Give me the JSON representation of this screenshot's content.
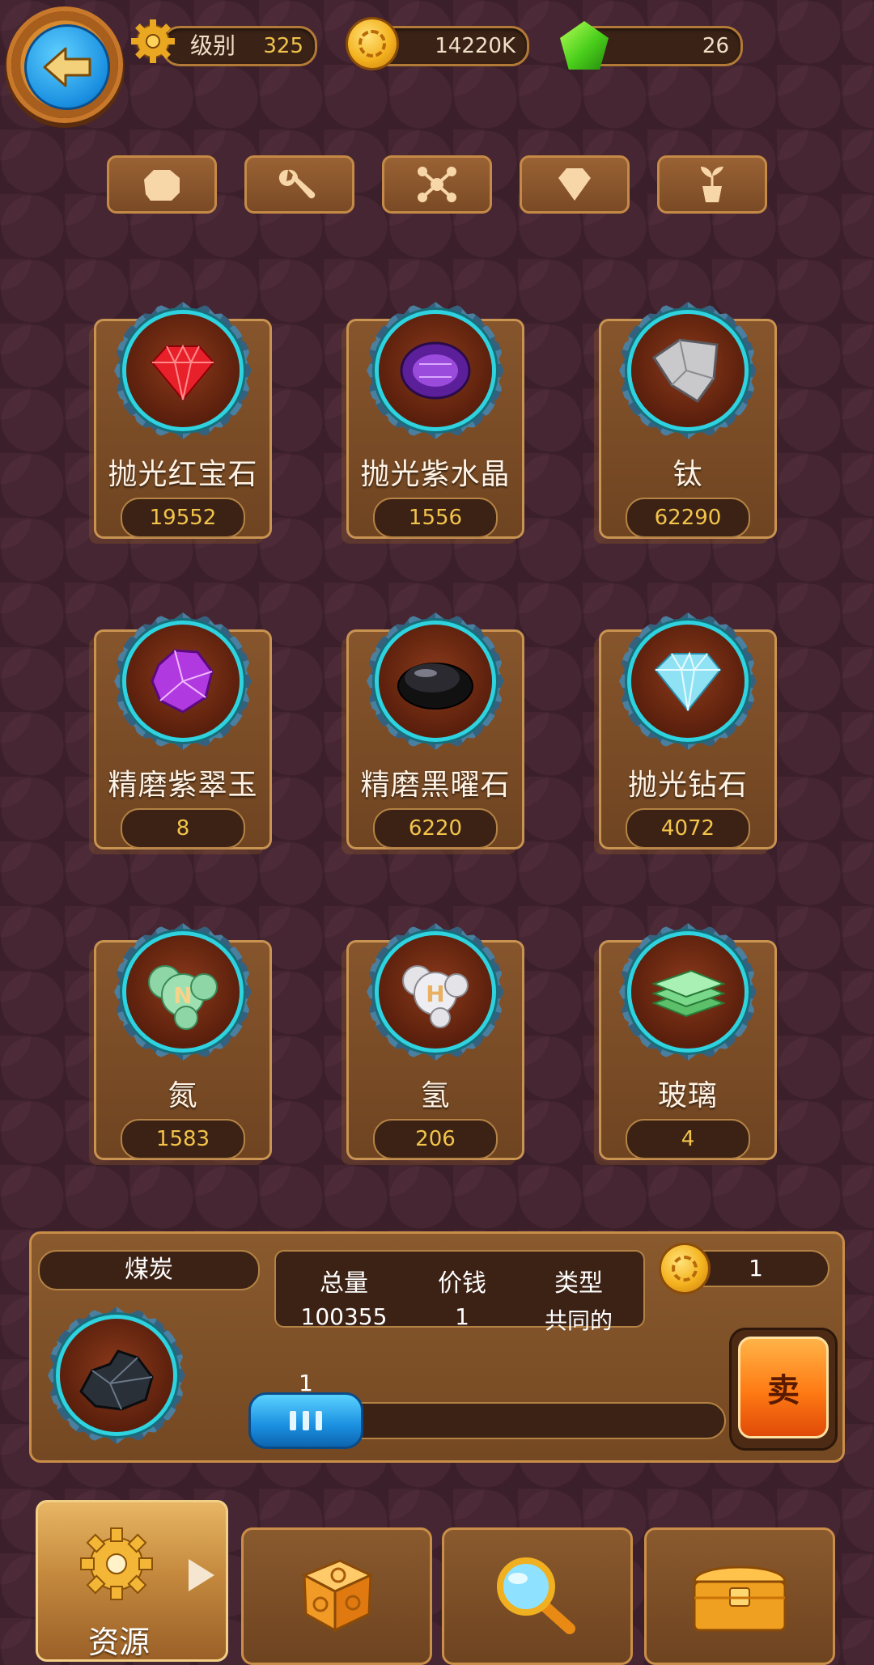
{
  "header": {
    "level_label": "级别",
    "level_value": "325",
    "coins": "14220K",
    "gems": "26"
  },
  "categories": [
    {
      "icon": "ore-icon"
    },
    {
      "icon": "wrench-icon"
    },
    {
      "icon": "molecule-icon"
    },
    {
      "icon": "diamond-icon"
    },
    {
      "icon": "plant-icon"
    }
  ],
  "items": [
    {
      "name": "抛光红宝石",
      "count": "19552",
      "icon": "red-ruby-icon"
    },
    {
      "name": "抛光紫水晶",
      "count": "1556",
      "icon": "amethyst-icon"
    },
    {
      "name": "钛",
      "count": "62290",
      "icon": "titanium-icon"
    },
    {
      "name": "精磨紫翠玉",
      "count": "8",
      "icon": "purple-jade-icon"
    },
    {
      "name": "精磨黑曜石",
      "count": "6220",
      "icon": "obsidian-icon"
    },
    {
      "name": "抛光钻石",
      "count": "4072",
      "icon": "diamond-gem-icon"
    },
    {
      "name": "氮",
      "count": "1583",
      "icon": "nitrogen-icon"
    },
    {
      "name": "氢",
      "count": "206",
      "icon": "hydrogen-icon"
    },
    {
      "name": "玻璃",
      "count": "4",
      "icon": "glass-icon"
    }
  ],
  "detail": {
    "name": "煤炭",
    "total_label": "总量",
    "total_value": "100355",
    "price_label": "价钱",
    "price_value": "1",
    "type_label": "类型",
    "type_value": "共同的",
    "sell_price": "1",
    "quantity": "1",
    "sell_label": "卖"
  },
  "nav": {
    "resources_label": "资源"
  },
  "colors": {
    "background": "#3b1f2a",
    "card": "#7a4a25",
    "accent_gold": "#f2c44c",
    "ring_cyan": "#2fd3e0",
    "sell_orange": "#ff7a14",
    "slider_blue": "#1a8fe0"
  }
}
